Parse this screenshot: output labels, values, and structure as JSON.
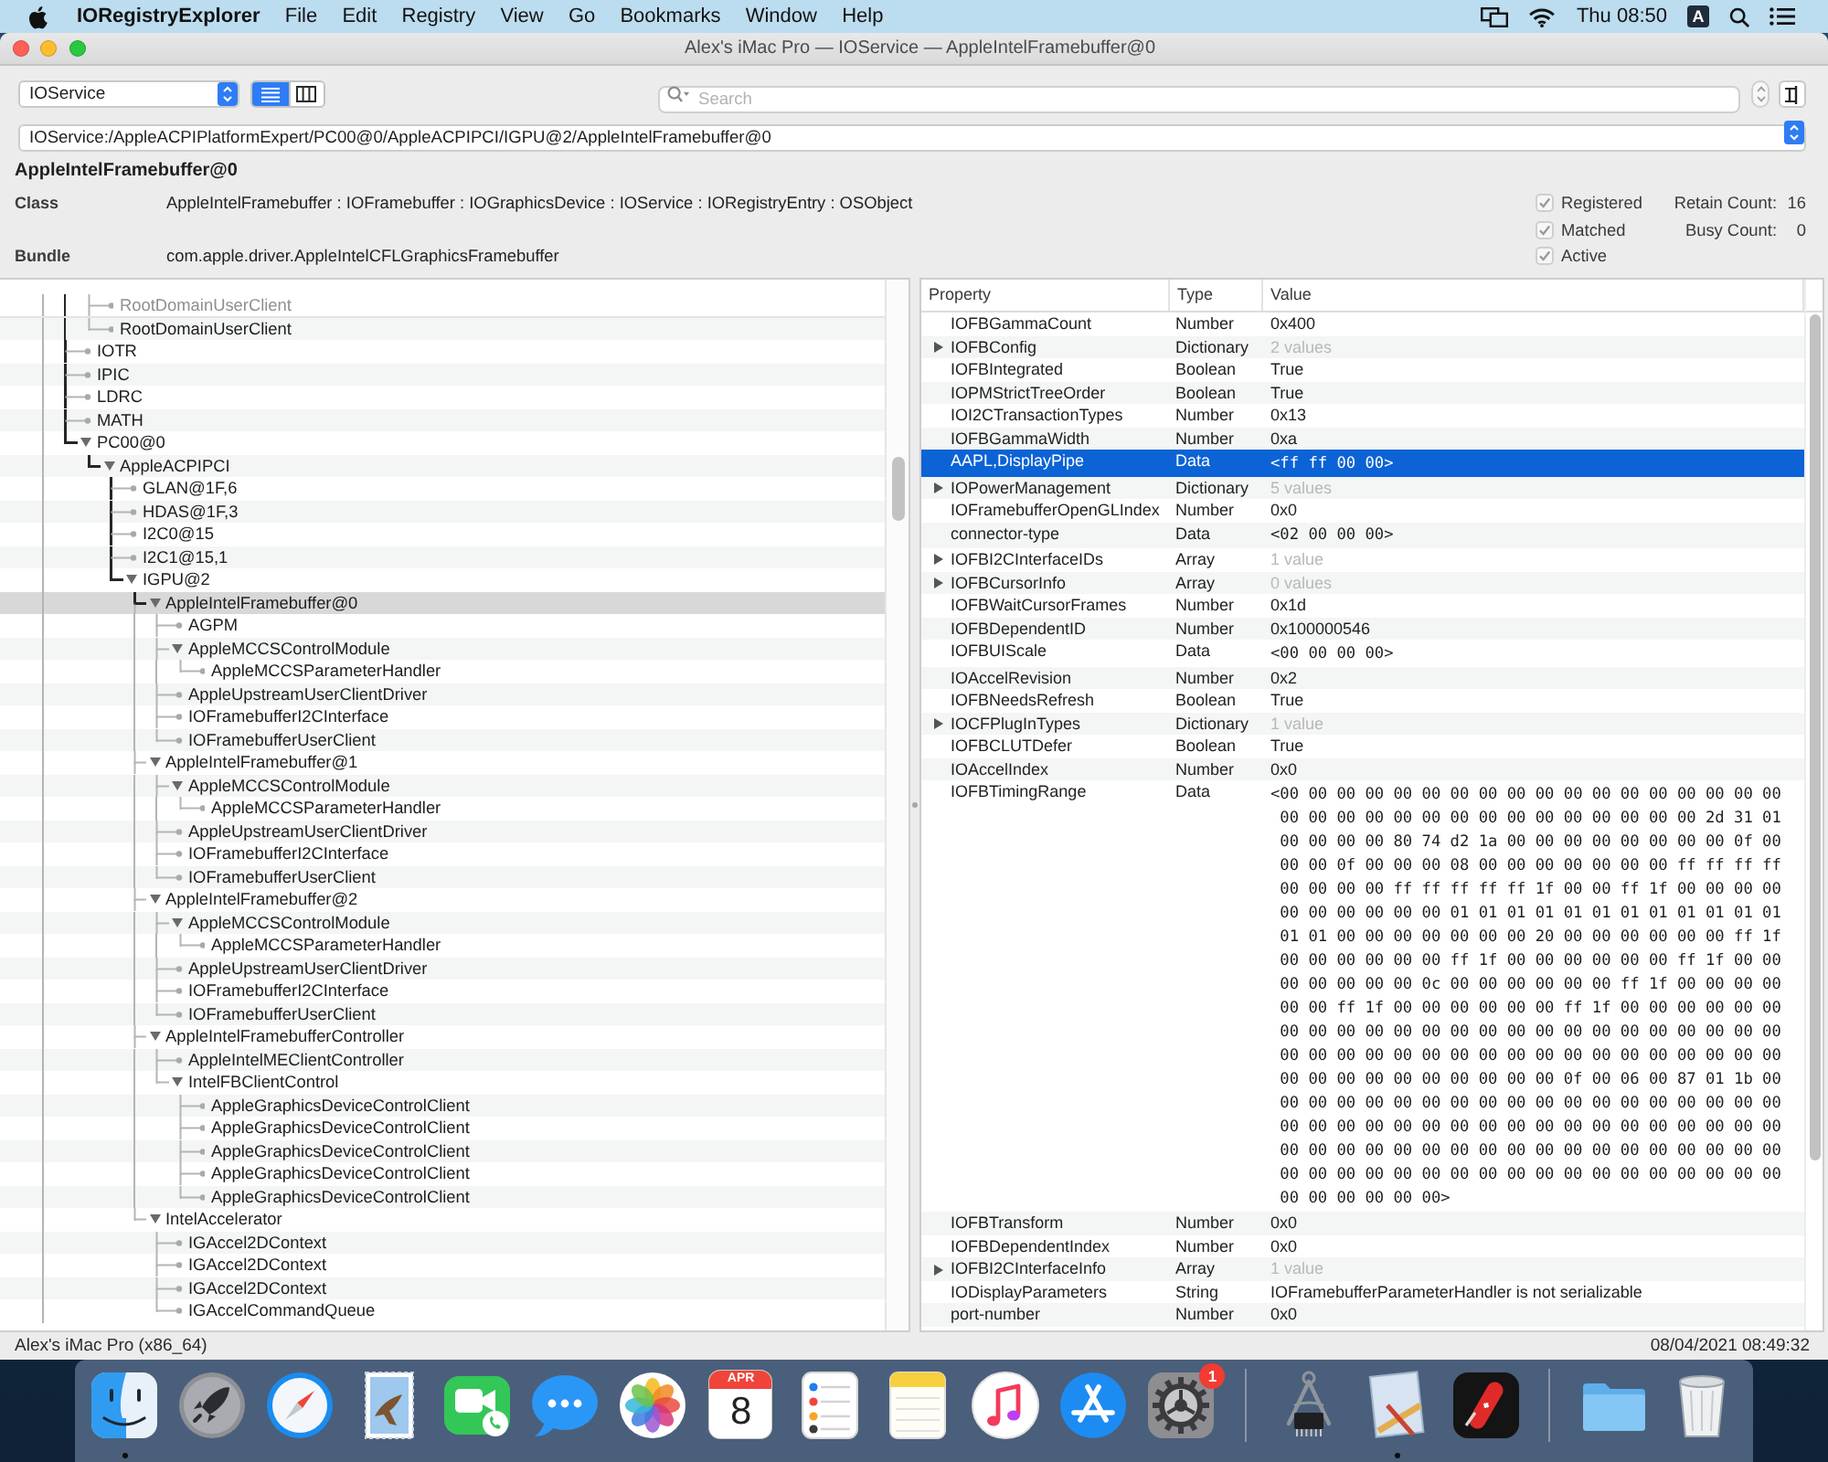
{
  "menu_bar": {
    "app_name": "IORegistryExplorer",
    "menus": [
      "File",
      "Edit",
      "Registry",
      "View",
      "Go",
      "Bookmarks",
      "Window",
      "Help"
    ],
    "clock": "Thu 08:50",
    "input_source": "A"
  },
  "window": {
    "title": "Alex's iMac Pro — IOService — AppleIntelFramebuffer@0"
  },
  "toolbar": {
    "plane": "IOService",
    "view_modes": [
      {
        "kind": "list",
        "selected": true
      },
      {
        "kind": "columns",
        "selected": false
      }
    ],
    "search": {
      "placeholder": "Search"
    },
    "path": "IOService:/AppleACPIPlatformExpert/PC00@0/AppleACPIPCI/IGPU@2/AppleIntelFramebuffer@0"
  },
  "info": {
    "name": "AppleIntelFramebuffer@0",
    "fields": [
      {
        "label": "Class",
        "value": "AppleIntelFramebuffer : IOFramebuffer : IOGraphicsDevice : IOService : IORegistryEntry : OSObject"
      },
      {
        "label": "Bundle",
        "value": "com.apple.driver.AppleIntelCFLGraphicsFramebuffer"
      }
    ],
    "flags": [
      {
        "label": "Registered",
        "checked": true
      },
      {
        "label": "Matched",
        "checked": true
      },
      {
        "label": "Active",
        "checked": true
      }
    ],
    "counts": [
      {
        "label": "Retain Count:",
        "value": "16"
      },
      {
        "label": "Busy Count:",
        "value": "0"
      }
    ]
  },
  "tree": {
    "items": [
      {
        "children": [
          {
            "label": "RootDomainUserClient",
            "selected": false
          },
          {
            "label": "RootDomainUserClient",
            "selected": false
          }
        ]
      },
      {
        "label": "IOTR",
        "selected": false
      },
      {
        "label": "IPIC",
        "selected": false
      },
      {
        "label": "LDRC",
        "selected": false
      },
      {
        "label": "MATH",
        "selected": false
      },
      {
        "label": "PC00@0",
        "selected": false,
        "expanded": true,
        "children": [
          {
            "label": "AppleACPIPCI",
            "selected": false,
            "expanded": true,
            "children": [
              {
                "label": "GLAN@1F,6",
                "selected": false
              },
              {
                "label": "HDAS@1F,3",
                "selected": false
              },
              {
                "label": "I2C0@15",
                "selected": false
              },
              {
                "label": "I2C1@15,1",
                "selected": false
              },
              {
                "label": "IGPU@2",
                "selected": false,
                "expanded": true,
                "children": [
                  {
                    "label": "AppleIntelFramebuffer@0",
                    "selected": true,
                    "expanded": true,
                    "children": [
                      {
                        "label": "AGPM",
                        "selected": false
                      },
                      {
                        "label": "AppleMCCSControlModule",
                        "selected": false,
                        "expanded": true,
                        "children": [
                          {
                            "label": "AppleMCCSParameterHandler",
                            "selected": false
                          }
                        ]
                      },
                      {
                        "label": "AppleUpstreamUserClientDriver",
                        "selected": false
                      },
                      {
                        "label": "IOFramebufferI2CInterface",
                        "selected": false
                      },
                      {
                        "label": "IOFramebufferUserClient",
                        "selected": false
                      }
                    ]
                  },
                  {
                    "label": "AppleIntelFramebuffer@1",
                    "selected": false,
                    "expanded": true,
                    "children": [
                      {
                        "label": "AppleMCCSControlModule",
                        "selected": false,
                        "expanded": true,
                        "children": [
                          {
                            "label": "AppleMCCSParameterHandler",
                            "selected": false
                          }
                        ]
                      },
                      {
                        "label": "AppleUpstreamUserClientDriver",
                        "selected": false
                      },
                      {
                        "label": "IOFramebufferI2CInterface",
                        "selected": false
                      },
                      {
                        "label": "IOFramebufferUserClient",
                        "selected": false
                      }
                    ]
                  },
                  {
                    "label": "AppleIntelFramebuffer@2",
                    "selected": false,
                    "expanded": true,
                    "children": [
                      {
                        "label": "AppleMCCSControlModule",
                        "selected": false,
                        "expanded": true,
                        "children": [
                          {
                            "label": "AppleMCCSParameterHandler",
                            "selected": false
                          }
                        ]
                      },
                      {
                        "label": "AppleUpstreamUserClientDriver",
                        "selected": false
                      },
                      {
                        "label": "IOFramebufferI2CInterface",
                        "selected": false
                      },
                      {
                        "label": "IOFramebufferUserClient",
                        "selected": false
                      }
                    ]
                  },
                  {
                    "label": "AppleIntelFramebufferController",
                    "selected": false,
                    "expanded": true,
                    "children": [
                      {
                        "label": "AppleIntelMEClientController",
                        "selected": false
                      },
                      {
                        "label": "IntelFBClientControl",
                        "selected": false,
                        "expanded": true,
                        "children": [
                          {
                            "label": "AppleGraphicsDeviceControlClient",
                            "selected": false
                          },
                          {
                            "label": "AppleGraphicsDeviceControlClient",
                            "selected": false
                          },
                          {
                            "label": "AppleGraphicsDeviceControlClient",
                            "selected": false
                          },
                          {
                            "label": "AppleGraphicsDeviceControlClient",
                            "selected": false
                          },
                          {
                            "label": "AppleGraphicsDeviceControlClient",
                            "selected": false
                          }
                        ]
                      }
                    ]
                  },
                  {
                    "label": "IntelAccelerator",
                    "selected": false,
                    "expanded": true,
                    "children": [
                      {
                        "label": "IGAccel2DContext",
                        "selected": false
                      },
                      {
                        "label": "IGAccel2DContext",
                        "selected": false
                      },
                      {
                        "label": "IGAccel2DContext",
                        "selected": false
                      },
                      {
                        "label": "IGAccelCommandQueue",
                        "selected": false
                      }
                    ]
                  }
                ]
              }
            ]
          }
        ]
      }
    ]
  },
  "properties": {
    "columns": [
      "Property",
      "Type",
      "Value"
    ],
    "rows": [
      {
        "property": "IOFBGammaCount",
        "type": "Number",
        "value": "0x400",
        "kind": "scalar",
        "selected": false
      },
      {
        "property": "IOFBConfig",
        "type": "Dictionary",
        "value": "2 values",
        "kind": "collection",
        "expanded": false,
        "selected": false
      },
      {
        "property": "IOFBIntegrated",
        "type": "Boolean",
        "value": "True",
        "kind": "scalar",
        "selected": false
      },
      {
        "property": "IOPMStrictTreeOrder",
        "type": "Boolean",
        "value": "True",
        "kind": "scalar",
        "selected": false
      },
      {
        "property": "IOI2CTransactionTypes",
        "type": "Number",
        "value": "0x13",
        "kind": "scalar",
        "selected": false
      },
      {
        "property": "IOFBGammaWidth",
        "type": "Number",
        "value": "0xa",
        "kind": "scalar",
        "selected": false
      },
      {
        "property": "AAPL,DisplayPipe",
        "type": "Data",
        "value": "<ff ff 00 00>",
        "kind": "data",
        "selected": true
      },
      {
        "property": "IOPowerManagement",
        "type": "Dictionary",
        "value": "5 values",
        "kind": "collection",
        "expanded": false,
        "selected": false
      },
      {
        "property": "IOFramebufferOpenGLIndex",
        "type": "Number",
        "value": "0x0",
        "kind": "scalar",
        "selected": false
      },
      {
        "property": "connector-type",
        "type": "Data",
        "value": "<02 00 00 00>",
        "kind": "data",
        "selected": false
      },
      {
        "property": "IOFBI2CInterfaceIDs",
        "type": "Array",
        "value": "1 value",
        "kind": "collection",
        "expanded": false,
        "selected": false
      },
      {
        "property": "IOFBCursorInfo",
        "type": "Array",
        "value": "0 values",
        "kind": "collection",
        "expanded": false,
        "selected": false
      },
      {
        "property": "IOFBWaitCursorFrames",
        "type": "Number",
        "value": "0x1d",
        "kind": "scalar",
        "selected": false
      },
      {
        "property": "IOFBDependentID",
        "type": "Number",
        "value": "0x100000546",
        "kind": "scalar",
        "selected": false
      },
      {
        "property": "IOFBUIScale",
        "type": "Data",
        "value": "<00 00 00 00>",
        "kind": "data",
        "selected": false
      },
      {
        "property": "IOAccelRevision",
        "type": "Number",
        "value": "0x2",
        "kind": "scalar",
        "selected": false
      },
      {
        "property": "IOFBNeedsRefresh",
        "type": "Boolean",
        "value": "True",
        "kind": "scalar",
        "selected": false
      },
      {
        "property": "IOCFPlugInTypes",
        "type": "Dictionary",
        "value": "1 value",
        "kind": "collection",
        "expanded": false,
        "selected": false
      },
      {
        "property": "IOFBCLUTDefer",
        "type": "Boolean",
        "value": "True",
        "kind": "scalar",
        "selected": false
      },
      {
        "property": "IOAccelIndex",
        "type": "Number",
        "value": "0x0",
        "kind": "scalar",
        "selected": false
      },
      {
        "property": "IOFBTimingRange",
        "type": "Data",
        "value": "<00 00 00 00 00 00 00 00 00 00 00 00 00 00 00 00 00 00 00 00 00 00 00 00 00 00 00 00 00 00 00 00 00 2d 31 01 00 00 00 00 80 74 d2 1a 00 00 00 00 00 00 00 00 0f 00 00 00 0f 00 00 00 08 00 00 00 00 00 00 00 ff ff ff ff 00 00 00 00 ff ff ff ff ff 1f 00 00 ff 1f 00 00 00 00 00 00 00 00 00 00 01 01 01 01 01 01 01 01 01 01 01 01 01 01 00 00 00 00 00 00 00 20 00 00 00 00 00 00 ff 1f 00 00 00 00 00 00 ff 1f 00 00 00 00 00 00 ff 1f 00 00 00 00 00 00 00 0c 00 00 00 00 00 00 ff 1f 00 00 00 00 00 00 ff 1f 00 00 00 00 00 00 ff 1f 00 00 00 00 00 00 00 00 00 00 00 00 00 00 00 00 00 00 00 00 00 00 00 00 00 00 00 00 00 00 00 00 00 00 00 00 00 00 00 00 00 00 00 00 00 00 00 00 00 00 00 00 0f 00 06 00 87 01 1b 00 00 00 00 00 00 00 00 00 00 00 00 00 00 00 00 00 00 00 00 00 00 00 00 00 00 00 00 00 00 00 00 00 00 00 00 00 00 00 00 00 00 00 00 00 00 00 00 00 00 00 00 00 00 00 00 00 00 00 00 00 00 00 00 00 00 00 00 00 00 00 00 00 00 00 00 00 00 00>",
        "kind": "data",
        "selected": false
      },
      {
        "property": "IOFBTransform",
        "type": "Number",
        "value": "0x0",
        "kind": "scalar",
        "selected": false
      },
      {
        "property": "IOFBDependentIndex",
        "type": "Number",
        "value": "0x0",
        "kind": "scalar",
        "selected": false
      },
      {
        "property": "IOFBI2CInterfaceInfo",
        "type": "Array",
        "value": "1 value",
        "kind": "collection",
        "expanded": false,
        "selected": false
      },
      {
        "property": "IODisplayParameters",
        "type": "String",
        "value": "IOFramebufferParameterHandler is not serializable",
        "kind": "scalar",
        "selected": false
      },
      {
        "property": "port-number",
        "type": "Number",
        "value": "0x0",
        "kind": "scalar",
        "selected": false
      }
    ]
  },
  "status_bar": {
    "machine": "Alex's iMac Pro (x86_64)",
    "timestamp": "08/04/2021 08:49:32"
  },
  "dock": {
    "items": [
      {
        "kind": "finder",
        "running": true
      },
      {
        "kind": "launchpad",
        "running": false
      },
      {
        "kind": "safari",
        "running": false
      },
      {
        "kind": "mail",
        "running": false
      },
      {
        "kind": "facetime",
        "running": false
      },
      {
        "kind": "messages",
        "running": false
      },
      {
        "kind": "photos",
        "running": false
      },
      {
        "kind": "calendar",
        "month": "APR",
        "day": "8",
        "running": false
      },
      {
        "kind": "reminders",
        "running": false
      },
      {
        "kind": "notes",
        "running": false
      },
      {
        "kind": "music",
        "running": false
      },
      {
        "kind": "app_store",
        "running": false
      },
      {
        "kind": "system_preferences",
        "badge": "1",
        "running": false
      },
      {
        "kind": "separator"
      },
      {
        "kind": "system_information",
        "running": false
      },
      {
        "kind": "blueprint",
        "running": true
      },
      {
        "kind": "knife",
        "running": false
      },
      {
        "kind": "separator"
      },
      {
        "kind": "folder",
        "running": false
      },
      {
        "kind": "trash",
        "running": false
      }
    ]
  }
}
